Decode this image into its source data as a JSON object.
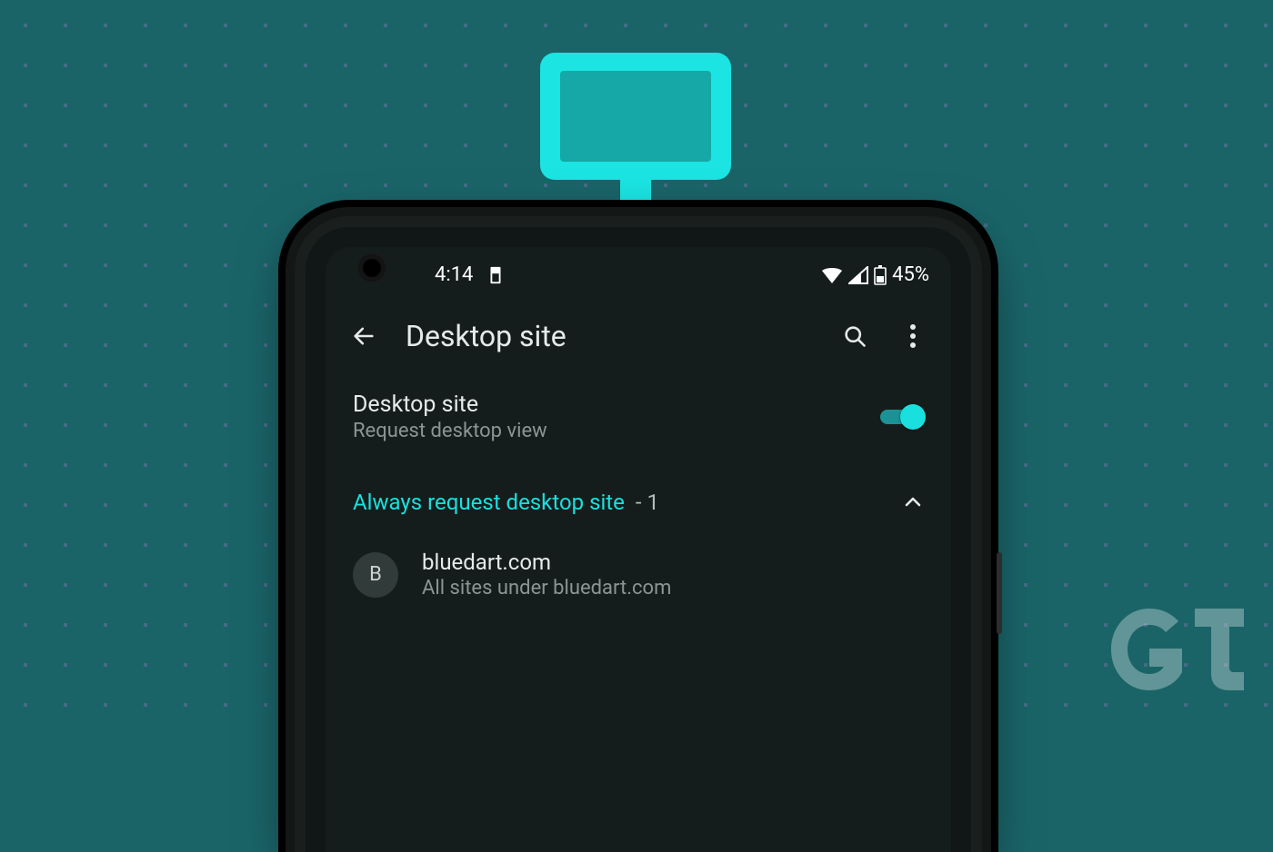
{
  "status_bar": {
    "time": "4:14",
    "battery_text": "45%"
  },
  "app_bar": {
    "title": "Desktop site"
  },
  "settings": {
    "desktop_site": {
      "title": "Desktop site",
      "subtitle": "Request desktop view",
      "enabled": true
    }
  },
  "section": {
    "label": "Always request desktop site",
    "count_text": "- 1"
  },
  "sites": [
    {
      "initial": "B",
      "title": "bluedart.com",
      "subtitle": "All sites under bluedart.com"
    }
  ],
  "colors": {
    "accent": "#19e0de",
    "background": "#1a6468"
  }
}
